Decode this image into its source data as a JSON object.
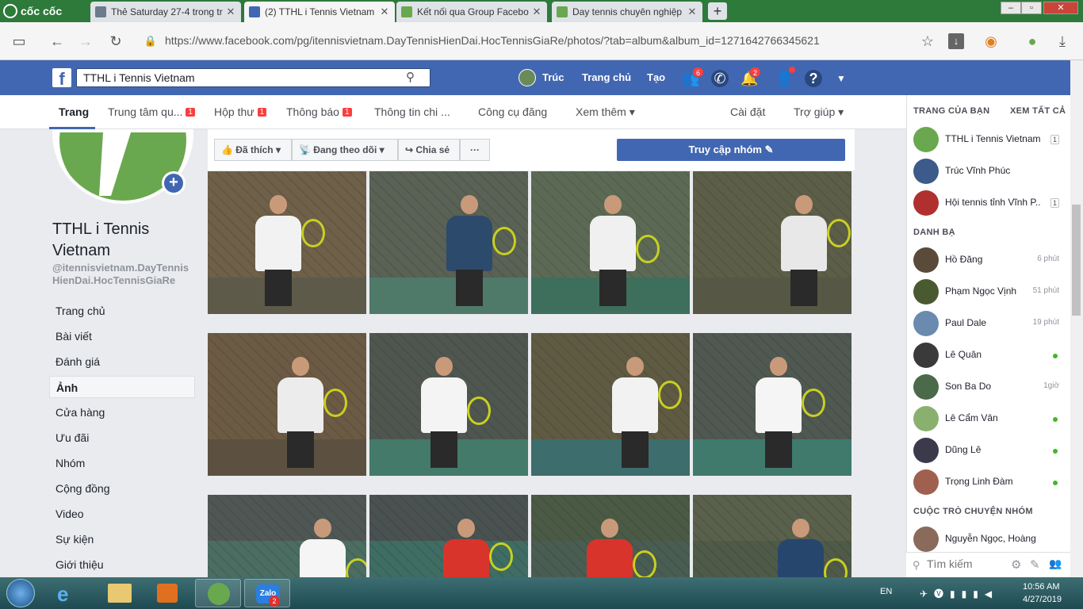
{
  "browser": {
    "logo": "cốc cốc",
    "tabs": [
      {
        "title": "Thẻ Saturday 27-4 trong tr",
        "favicon_color": "#6b7b8c"
      },
      {
        "title": "(2) TTHL i Tennis Vietnam",
        "favicon_color": "#4267b2"
      },
      {
        "title": "Kết nối qua Group Facebo",
        "favicon_color": "#6aa84f"
      },
      {
        "title": "Day tennis chuyên nghiệp",
        "favicon_color": "#6aa84f"
      }
    ],
    "new_tab": "+",
    "url": "https://www.facebook.com/pg/itennisvietnam.DayTennisHienDai.HocTennisGiaRe/photos/?tab=album&album_id=1271642766345621"
  },
  "fb_header": {
    "search_value": "TTHL i Tennis Vietnam",
    "user_name": "Trúc",
    "home": "Trang chủ",
    "create": "Tạo",
    "friend_badge": "6",
    "notif_badge": "2"
  },
  "page_tabs": [
    {
      "label": "Trang",
      "badge": ""
    },
    {
      "label": "Trung tâm qu...",
      "badge": "1"
    },
    {
      "label": "Hộp thư",
      "badge": "1"
    },
    {
      "label": "Thông báo",
      "badge": "1"
    },
    {
      "label": "Thông tin chi ...",
      "badge": ""
    },
    {
      "label": "Công cụ đăng",
      "badge": ""
    },
    {
      "label": "Xem thêm ▾",
      "badge": ""
    },
    {
      "label": "Cài đặt",
      "badge": ""
    },
    {
      "label": "Trợ giúp ▾",
      "badge": ""
    }
  ],
  "page": {
    "name": "TTHL i Tennis Vietnam",
    "handle": "@itennisvietnam.DayTennisHienDai.HocTennisGiaRe",
    "nav": [
      "Trang chủ",
      "Bài viết",
      "Đánh giá",
      "Ảnh",
      "Cửa hàng",
      "Ưu đãi",
      "Nhóm",
      "Cộng đồng",
      "Video",
      "Sự kiện",
      "Giới thiệu"
    ],
    "active_nav": "Ảnh"
  },
  "toolbar": {
    "like": "Đã thích",
    "follow": "Đang theo dõi",
    "share": "Chia sẻ",
    "more": "···",
    "visit_group": "Truy cập nhóm"
  },
  "photos": [
    {
      "shirt": "#f2f2f2",
      "bg": "#6e6049",
      "court": "#5d5a4a"
    },
    {
      "shirt": "#2c4a6b",
      "bg": "#5a6155",
      "court": "#4f7a6a"
    },
    {
      "shirt": "#f0f0f0",
      "bg": "#5c6a55",
      "court": "#3e6e5c"
    },
    {
      "shirt": "#e8e8e8",
      "bg": "#5c5e48",
      "court": "#565845"
    },
    {
      "shirt": "#ececec",
      "bg": "#6b5a44",
      "court": "#5c5140"
    },
    {
      "shirt": "#f4f4f4",
      "bg": "#4f5650",
      "court": "#447a69"
    },
    {
      "shirt": "#f2f2f2",
      "bg": "#5f5a42",
      "court": "#3d6d6c"
    },
    {
      "shirt": "#f5f5f5",
      "bg": "#505852",
      "court": "#3f7a6d"
    },
    {
      "shirt": "#f5f5f5",
      "bg": "#4f5755",
      "court": "#4b6d62"
    },
    {
      "shirt": "#d9342b",
      "bg": "#4a5151",
      "court": "#3f6c63"
    },
    {
      "shirt": "#d9342b",
      "bg": "#4b5a45",
      "court": "#4a5d52"
    },
    {
      "shirt": "#26466e",
      "bg": "#59604b",
      "court": "#4f5a48"
    }
  ],
  "right_sidebar": {
    "your_pages": "TRANG CỦA BẠN",
    "see_all": "XEM TẤT CẢ",
    "pages": [
      {
        "name": "TTHL i Tennis Vietnam",
        "count": "1",
        "color": "#6aa84f"
      },
      {
        "name": "Trúc Vĩnh Phúc",
        "count": "",
        "color": "#3c5a8a"
      },
      {
        "name": "Hội tennis tỉnh Vĩnh P...",
        "count": "1",
        "color": "#b03030"
      }
    ],
    "contacts_title": "DANH BẠ",
    "contacts": [
      {
        "name": "Hồ Đăng",
        "status": "6 phút",
        "online": false,
        "color": "#5a4a3a"
      },
      {
        "name": "Phạm Ngọc Vịnh",
        "status": "51 phút",
        "online": false,
        "color": "#4a5a30"
      },
      {
        "name": "Paul Dale",
        "status": "19 phút",
        "online": false,
        "color": "#6a8ab0"
      },
      {
        "name": "Lê Quân",
        "status": "",
        "online": true,
        "color": "#3a3a3a"
      },
      {
        "name": "Son Ba Do",
        "status": "1giờ",
        "online": false,
        "color": "#4a6a4a"
      },
      {
        "name": "Lê Cẩm Vân",
        "status": "",
        "online": true,
        "color": "#8ab070"
      },
      {
        "name": "Dũng Lê",
        "status": "",
        "online": true,
        "color": "#3a3a4a"
      },
      {
        "name": "Trọng Linh Đàm",
        "status": "",
        "online": true,
        "color": "#a06050"
      }
    ],
    "group_chats_title": "CUỘC TRÒ CHUYỆN NHÓM",
    "group_chats": [
      {
        "name": "Nguyễn Ngọc, Hoàng",
        "color": "#8a6a5a"
      }
    ],
    "search_placeholder": "Tìm kiếm"
  },
  "taskbar": {
    "lang": "EN",
    "time": "10:56 AM",
    "date": "4/27/2019",
    "zalo_label": "Zalo",
    "zalo_badge": "2"
  }
}
